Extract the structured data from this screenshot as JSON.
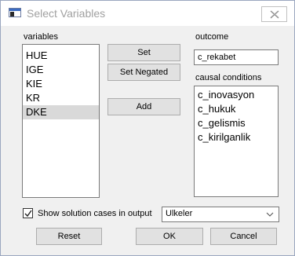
{
  "window": {
    "title": "Select Variables"
  },
  "variables": {
    "label": "variables",
    "items": [
      "HUE",
      "IGE",
      "KIE",
      "KR",
      "DKE"
    ],
    "selected_index": 4
  },
  "buttons": {
    "set": "Set",
    "set_negated": "Set Negated",
    "add": "Add",
    "reset": "Reset",
    "ok": "OK",
    "cancel": "Cancel"
  },
  "outcome": {
    "label": "outcome",
    "value": "c_rekabet"
  },
  "causal_conditions": {
    "label": "causal conditions",
    "items": [
      "c_inovasyon",
      "c_hukuk",
      "c_gelismis",
      "c_kirilganlik"
    ]
  },
  "options": {
    "show_solution_label": "Show solution cases in output",
    "show_solution_checked": true,
    "case_column_selected": "Ulkeler"
  },
  "icons": {
    "app": "window-app-icon",
    "close": "close-icon",
    "checkmark": "checkmark-icon",
    "dropdown": "chevron-down-icon"
  }
}
